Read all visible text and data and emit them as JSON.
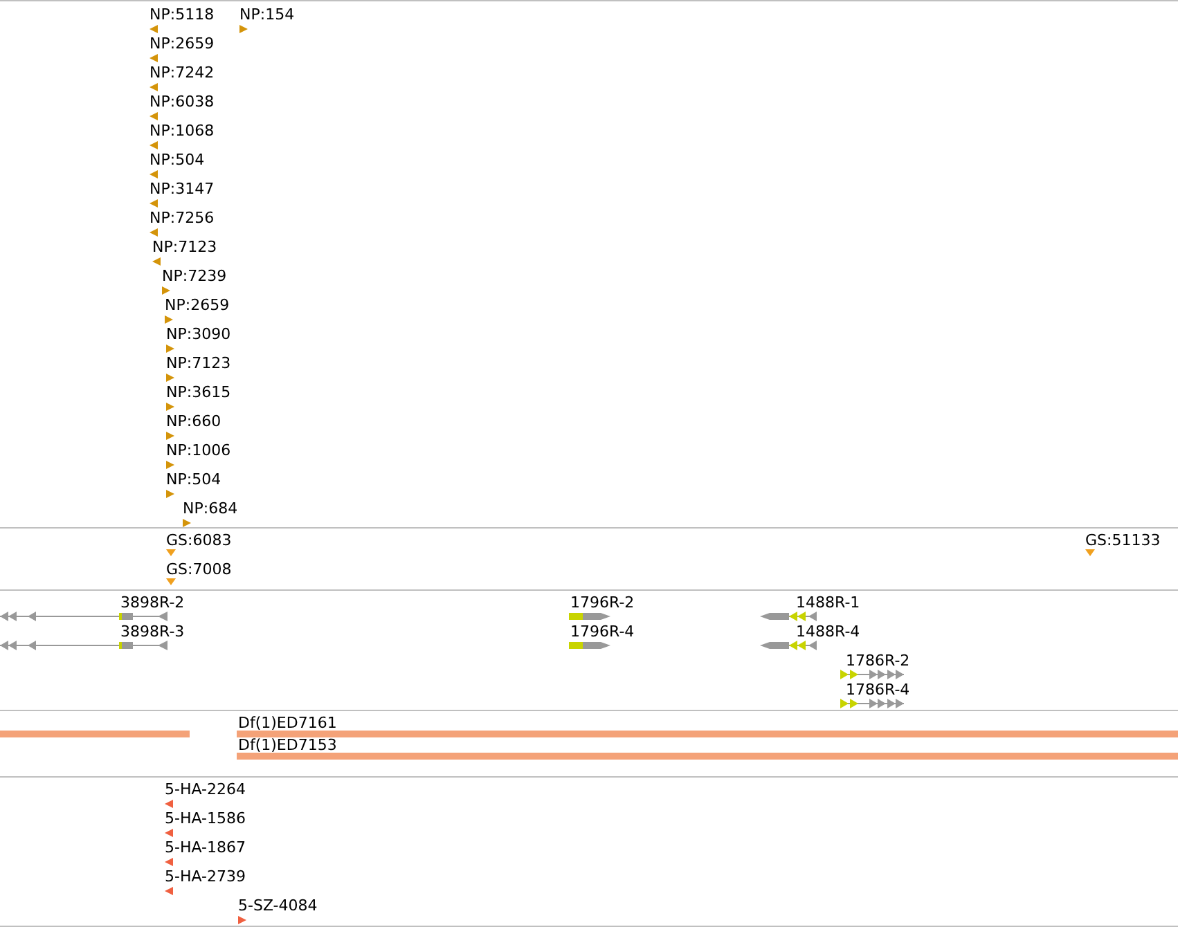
{
  "tracks": [
    {
      "kind": "points",
      "color": "#d4940a",
      "features": [
        {
          "label": "NP:5118",
          "reverse": true
        },
        {
          "label": "NP:154",
          "reverse": false
        },
        {
          "label": "NP:2659",
          "reverse": true
        },
        {
          "label": "NP:7242",
          "reverse": true
        },
        {
          "label": "NP:6038",
          "reverse": true
        },
        {
          "label": "NP:1068",
          "reverse": true
        },
        {
          "label": "NP:504",
          "reverse": true
        },
        {
          "label": "NP:3147",
          "reverse": true
        },
        {
          "label": "NP:7256",
          "reverse": true
        },
        {
          "label": "NP:7123",
          "reverse": true
        },
        {
          "label": "NP:7239",
          "reverse": false
        },
        {
          "label": "NP:2659",
          "reverse": false
        },
        {
          "label": "NP:3090",
          "reverse": false
        },
        {
          "label": "NP:7123",
          "reverse": false
        },
        {
          "label": "NP:3615",
          "reverse": false
        },
        {
          "label": "NP:660",
          "reverse": false
        },
        {
          "label": "NP:1006",
          "reverse": false
        },
        {
          "label": "NP:504",
          "reverse": false
        },
        {
          "label": "NP:684",
          "reverse": false
        }
      ]
    },
    {
      "kind": "markers",
      "color": "#f0a01e",
      "features": [
        {
          "label": "GS:6083"
        },
        {
          "label": "GS:7008"
        },
        {
          "label": "GS:51133"
        }
      ]
    },
    {
      "kind": "genes",
      "color": "#999999",
      "features": [
        {
          "label": "3898R-2",
          "reverse": true
        },
        {
          "label": "3898R-3",
          "reverse": true
        },
        {
          "label": "1796R-2",
          "reverse": false
        },
        {
          "label": "1796R-4",
          "reverse": false
        },
        {
          "label": "1488R-1",
          "reverse": true
        },
        {
          "label": "1488R-4",
          "reverse": true
        },
        {
          "label": "1786R-2",
          "reverse": false
        },
        {
          "label": "1786R-4",
          "reverse": false
        }
      ]
    },
    {
      "kind": "bars",
      "color": "#f4a278",
      "features": [
        {
          "label": "Df(1)ED7161"
        },
        {
          "label": "Df(1)ED7153"
        }
      ]
    },
    {
      "kind": "points",
      "color": "#f06040",
      "features": [
        {
          "label": "5-HA-2264",
          "reverse": true
        },
        {
          "label": "5-HA-1586",
          "reverse": true
        },
        {
          "label": "5-HA-1867",
          "reverse": true
        },
        {
          "label": "5-HA-2739",
          "reverse": true
        },
        {
          "label": "5-SZ-4084",
          "reverse": false
        }
      ]
    }
  ]
}
